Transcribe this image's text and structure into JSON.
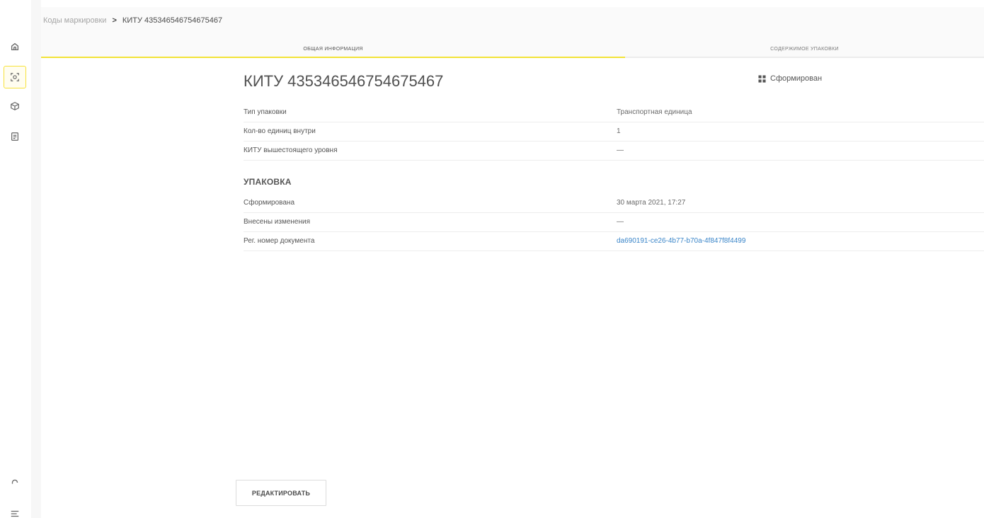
{
  "breadcrumb": {
    "parent": "Коды маркировки",
    "separator": ">",
    "current": "КИТУ 435346546754675467"
  },
  "tabs": [
    {
      "label": "Общая информация",
      "active": true
    },
    {
      "label": "Содержимое упаковки",
      "active": false
    }
  ],
  "page": {
    "title": "КИТУ 435346546754675467",
    "status_label": "Сформирован",
    "status_icon": "box-grid-icon"
  },
  "details": [
    {
      "label": "Тип упаковки",
      "value": "Транспортная единица"
    },
    {
      "label": "Кол-во единиц внутри",
      "value": "1"
    },
    {
      "label": "КИТУ вышестоящего уровня",
      "value": "—"
    }
  ],
  "packaging": {
    "section_title": "Упаковка",
    "rows": [
      {
        "label": "Сформирована",
        "value": "30 марта 2021, 17:27"
      },
      {
        "label": "Внесены изменения",
        "value": "—"
      },
      {
        "label": "Рег. номер документа",
        "value": "da690191-ce26-4b77-b70a-4f847f8f4499"
      }
    ]
  },
  "actions": {
    "edit_label": "РЕДАКТИРОВАТЬ"
  },
  "sidebar": {
    "items": [
      {
        "icon": "home-icon"
      },
      {
        "icon": "scan-icon",
        "active": true
      },
      {
        "icon": "package-icon"
      },
      {
        "icon": "document-icon"
      }
    ],
    "bottom": [
      {
        "icon": "support-icon"
      },
      {
        "icon": "menu-icon"
      }
    ]
  },
  "colors": {
    "accent": "#f2e337",
    "link": "#3a85c9"
  }
}
